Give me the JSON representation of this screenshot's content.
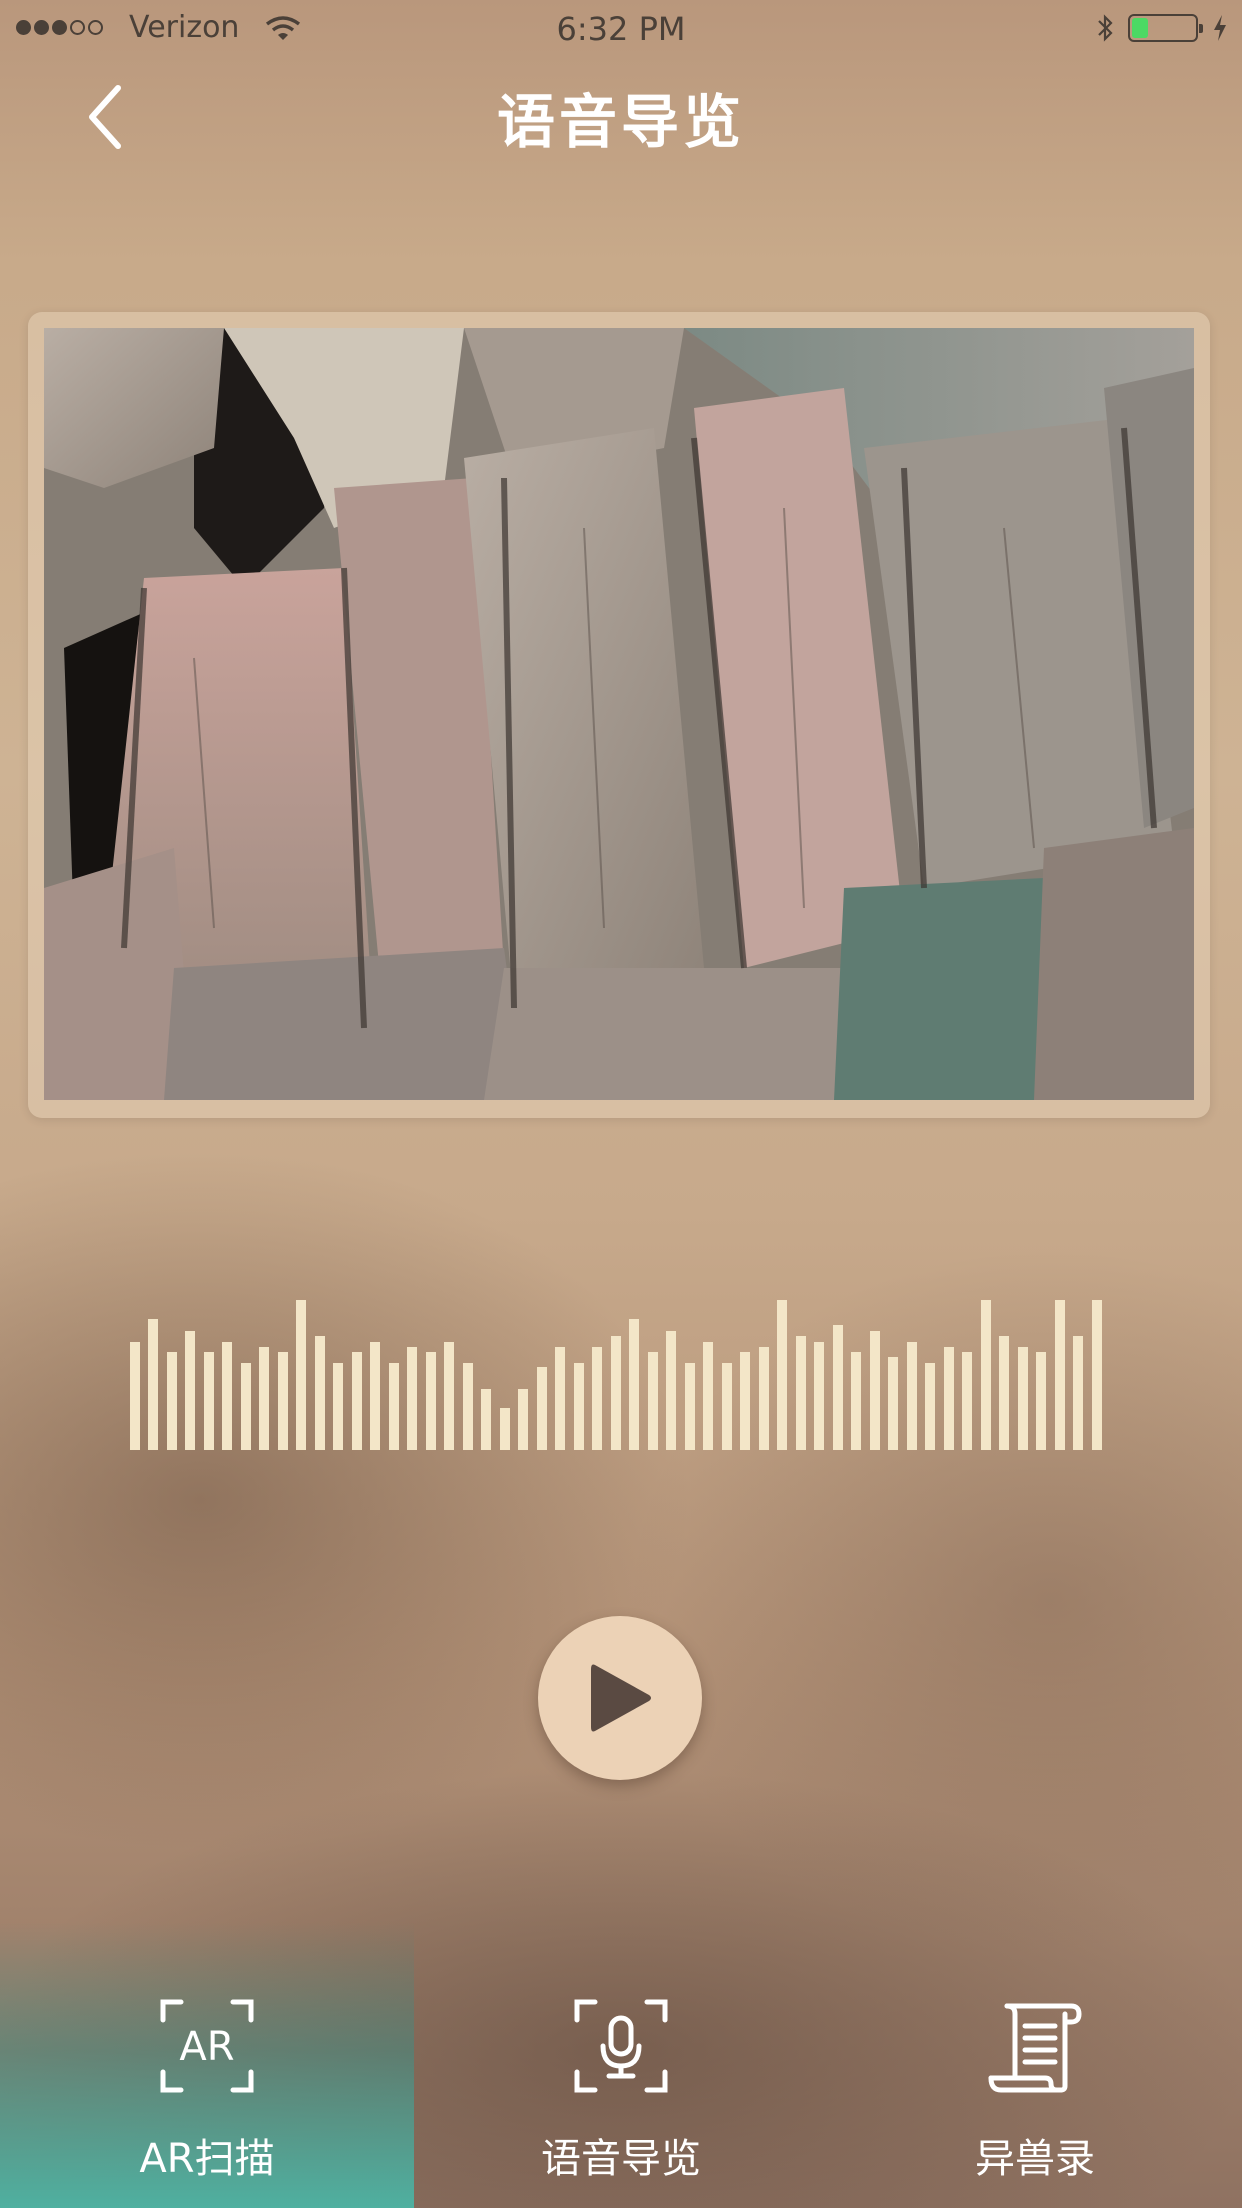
{
  "status_bar": {
    "carrier": "Verizon",
    "time": "6:32 PM",
    "signal_bars_filled": 3,
    "signal_bars_total": 5,
    "battery_level": 0.25,
    "icons": [
      "wifi-icon",
      "bluetooth-icon",
      "battery-icon",
      "charging-icon"
    ]
  },
  "header": {
    "title": "语音导览",
    "back_icon": "chevron-left-icon"
  },
  "media": {
    "image_icon": "rock-formation-photo"
  },
  "audio": {
    "waveform_levels": [
      0.72,
      0.87,
      0.65,
      0.79,
      0.65,
      0.72,
      0.58,
      0.69,
      0.65,
      1.0,
      0.76,
      0.58,
      0.65,
      0.72,
      0.58,
      0.69,
      0.65,
      0.72,
      0.58,
      0.41,
      0.28,
      0.41,
      0.55,
      0.69,
      0.58,
      0.69,
      0.76,
      0.87,
      0.65,
      0.79,
      0.58,
      0.72,
      0.58,
      0.65,
      0.69,
      1.0,
      0.76,
      0.72,
      0.83,
      0.65,
      0.79,
      0.62,
      0.72,
      0.58,
      0.69,
      0.65,
      1.0,
      0.76,
      0.69,
      0.65,
      1.0,
      0.76,
      1.0
    ],
    "play_icon": "play-icon"
  },
  "tabbar": {
    "tabs": [
      {
        "label": "AR扫描",
        "icon": "ar-scan-icon",
        "active": true
      },
      {
        "label": "语音导览",
        "icon": "microphone-scan-icon",
        "active": false
      },
      {
        "label": "异兽录",
        "icon": "scroll-icon",
        "active": false
      }
    ]
  },
  "colors": {
    "accent_active_tab": "#4fb0a0",
    "waveform": "#f3e6c8",
    "play_button": "#ecd2b6",
    "play_glyph": "#5a4a42"
  }
}
